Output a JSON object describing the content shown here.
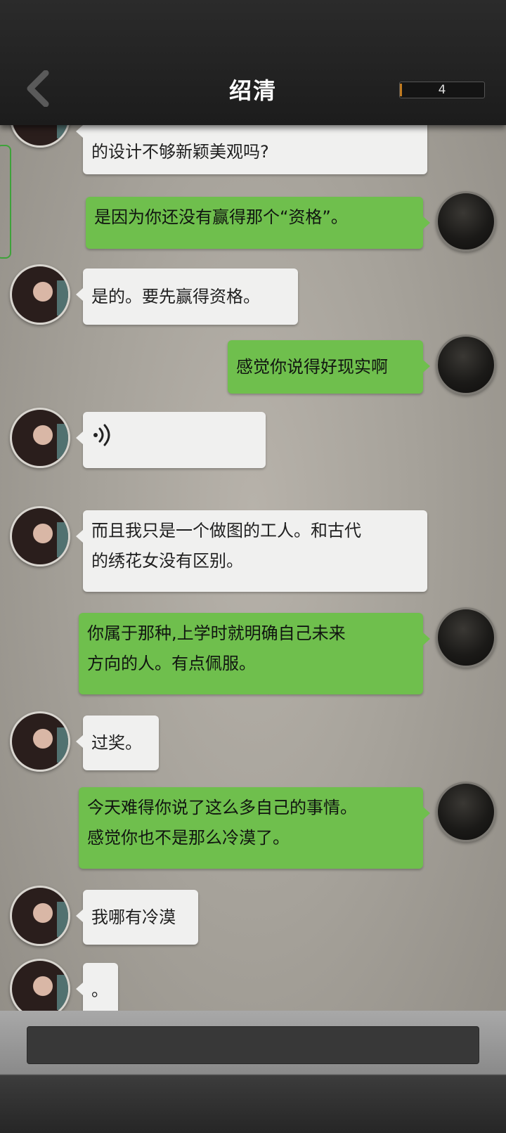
{
  "header": {
    "title": "绍清",
    "counter": "4"
  },
  "messages": [
    {
      "from": "npc",
      "lines": [
        "的设计不够新颖美观吗?"
      ]
    },
    {
      "from": "me",
      "lines": [
        "是因为你还没有赢得那个“资格”。"
      ]
    },
    {
      "from": "npc",
      "lines": [
        "是的。要先赢得资格。"
      ]
    },
    {
      "from": "me",
      "lines": [
        "感觉你说得好现实啊"
      ]
    },
    {
      "from": "npc",
      "type": "voice",
      "icon": "voice-icon"
    },
    {
      "from": "npc",
      "lines": [
        "而且我只是一个做图的工人。和古代",
        "的绣花女没有区别。"
      ]
    },
    {
      "from": "me",
      "lines": [
        "你属于那种,上学时就明确自己未来",
        "方向的人。有点佩服。"
      ]
    },
    {
      "from": "npc",
      "lines": [
        "过奖。"
      ]
    },
    {
      "from": "me",
      "lines": [
        "今天难得你说了这么多自己的事情。",
        "感觉你也不是那么冷漠了。"
      ]
    },
    {
      "from": "npc",
      "lines": [
        "我哪有冷漠"
      ]
    },
    {
      "from": "npc",
      "lines": [
        "。"
      ]
    }
  ],
  "input": {
    "value": ""
  },
  "colors": {
    "me_bubble": "#6fbf4d",
    "npc_bubble": "#f0f0ef",
    "header": "#1f1f1f"
  }
}
